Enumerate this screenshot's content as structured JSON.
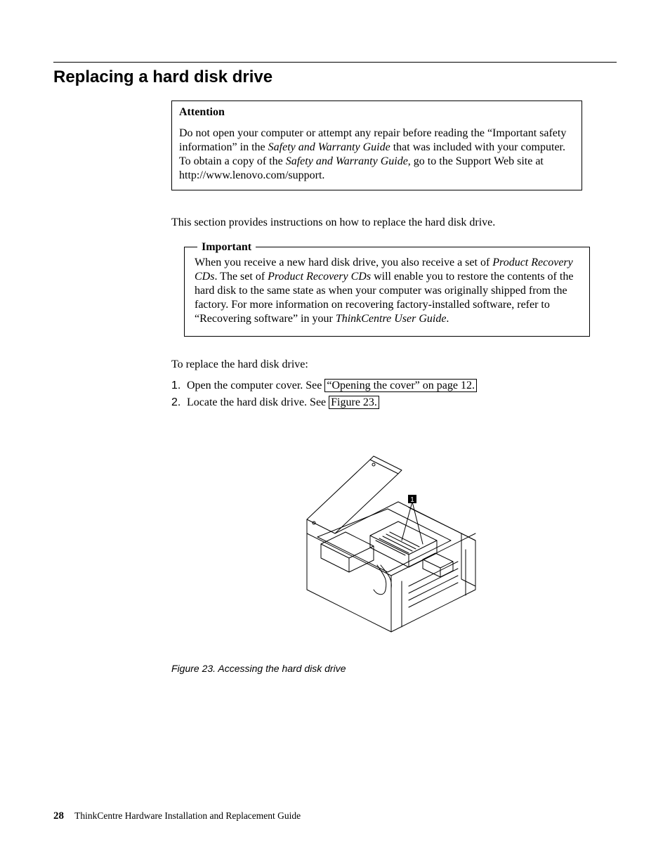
{
  "heading": "Replacing a hard disk drive",
  "attention": {
    "title": "Attention",
    "body_a": "Do not open your computer or attempt any repair before reading the “Important safety information” in the ",
    "body_b": "Safety and Warranty Guide",
    "body_c": " that was included with your computer. To obtain a copy of the ",
    "body_d": "Safety and Warranty Guide",
    "body_e": ", go to the Support Web site at http://www.lenovo.com/support."
  },
  "intro": "This section provides instructions on how to replace the hard disk drive.",
  "important": {
    "legend": "Important",
    "a": "When you receive a new hard disk drive, you also receive a set of ",
    "b": "Product Recovery CDs",
    "c": ". The set of ",
    "d": "Product Recovery CDs",
    "e": " will enable you to restore the contents of the hard disk to the same state as when your computer was originally shipped from the factory. For more information on recovering factory-installed software, refer to “Recovering software” in your ",
    "f": "ThinkCentre User Guide",
    "g": "."
  },
  "list_intro": "To replace the hard disk drive:",
  "steps": [
    {
      "num": "1.",
      "pre": "Open the computer cover. See ",
      "link": "“Opening the cover” on page 12."
    },
    {
      "num": "2.",
      "pre": "Locate the hard disk drive. See ",
      "link": "Figure 23."
    }
  ],
  "figure": {
    "callout": "1",
    "caption": "Figure 23. Accessing the hard disk drive"
  },
  "footer": {
    "page": "28",
    "text": "ThinkCentre Hardware Installation and Replacement Guide"
  }
}
